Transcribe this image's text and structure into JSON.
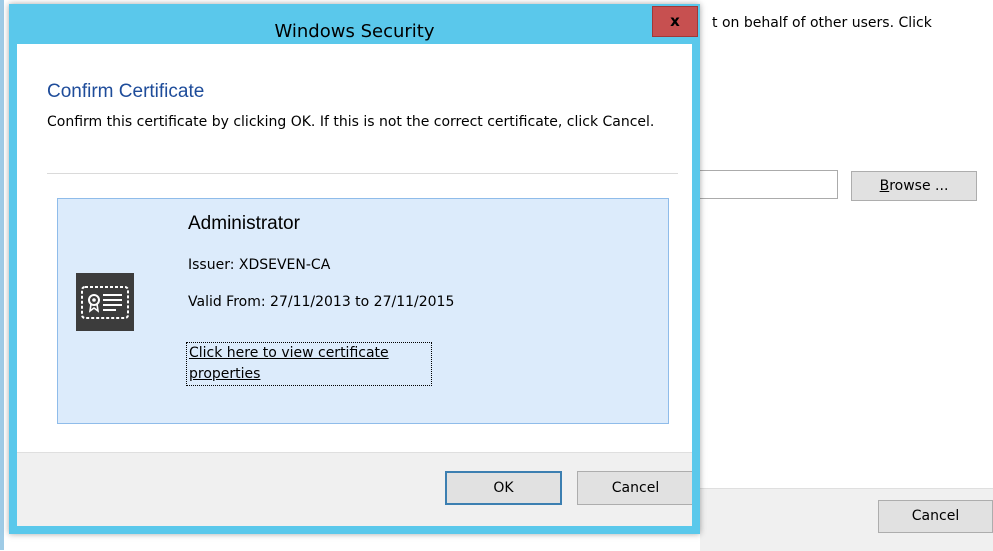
{
  "background_window": {
    "instruction_fragment": "t on behalf of other users. Click",
    "browse_button_label": "Browse ...",
    "browse_accelerator": "B",
    "cancel_button_label": "Cancel"
  },
  "dialog": {
    "title": "Windows Security",
    "close_label": "x",
    "heading": "Confirm Certificate",
    "message": "Confirm this certificate by clicking OK. If this is not the correct certificate, click Cancel.",
    "certificate": {
      "name": "Administrator",
      "issuer": "Issuer: XDSEVEN-CA",
      "valid": "Valid From: 27/11/2013 to 27/11/2015",
      "link": "Click here to view certificate properties",
      "icon": "certificate-icon"
    },
    "ok_label": "OK",
    "cancel_label": "Cancel"
  },
  "colors": {
    "title_bar": "#5ac8eb",
    "close_button": "#c75050",
    "heading": "#1e4c9a",
    "cert_card_bg": "#dcebfb",
    "cert_card_border": "#8fbcea"
  }
}
